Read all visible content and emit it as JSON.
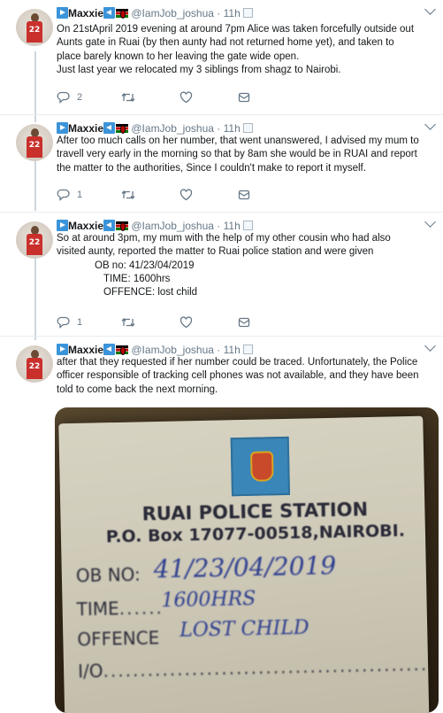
{
  "tweets": [
    {
      "name": "Maxxie",
      "handle": "@IamJob_joshua",
      "separator": "·",
      "time": "11h",
      "lines": [
        "On 21stApril 2019 evening at around 7pm Alice was taken forcefully outside out",
        "Aunts gate in Ruai (by then aunty had not returned home yet), and taken to",
        "place barely known to her leaving the gate wide open.",
        "Just last year we relocated my 3 siblings from shagz to Nairobi."
      ],
      "reply_count": "2",
      "retweet_count": "",
      "like_count": ""
    },
    {
      "name": "Maxxie",
      "handle": "@IamJob_joshua",
      "separator": "·",
      "time": "11h",
      "lines": [
        "After too much calls on her number, that went unanswered, I advised my mum to",
        "travell very early in the morning so that by 8am she would be in RUAI and report",
        "the matter to the authorities, Since  I couldn't make to report it myself."
      ],
      "reply_count": "1",
      "retweet_count": "",
      "like_count": ""
    },
    {
      "name": "Maxxie",
      "handle": "@IamJob_joshua",
      "separator": "·",
      "time": "11h",
      "lines": [
        "So at around 3pm, my mum with the help of my other cousin who had also",
        "visited aunty, reported the matter to Ruai police station and were given"
      ],
      "ob_lines": [
        "OB no: 41/23/04/2019",
        "TIME: 1600hrs",
        "OFFENCE: lost child"
      ],
      "reply_count": "1",
      "retweet_count": "",
      "like_count": ""
    },
    {
      "name": "Maxxie",
      "handle": "@IamJob_joshua",
      "separator": "·",
      "time": "11h",
      "lines": [
        "after that they requested if her number could be traced. Unfortunately, the Police",
        "officer responsible of tracking cell phones was not available, and they have been",
        "told to come back the next morning."
      ]
    }
  ],
  "photo": {
    "station": "RUAI POLICE STATION",
    "address": "P.O. Box 17077-00518,NAIROBI.",
    "ob_label": "OB NO:",
    "ob_value": "41/23/04/2019",
    "time_label": "TIME",
    "time_value": "1600HRS",
    "offence_label": "OFFENCE",
    "offence_value": "LOST CHILD",
    "io_label": "I/O"
  },
  "colors": {
    "accent": "#3b94d9",
    "text": "#14171a",
    "muted": "#657786",
    "divider": "#e6ecf0"
  },
  "icons": [
    "reply-icon",
    "retweet-icon",
    "like-icon",
    "message-icon",
    "chevron-down-icon"
  ]
}
